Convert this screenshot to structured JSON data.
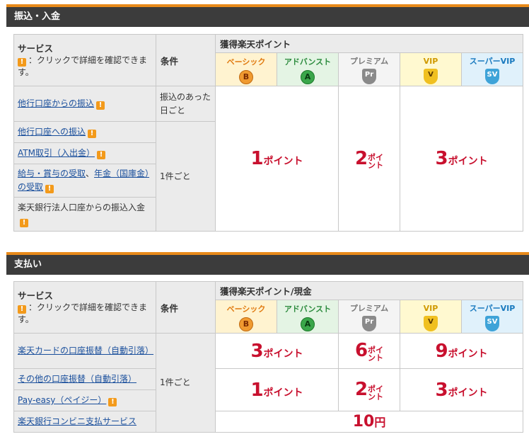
{
  "deposit": {
    "title": "振込・入金",
    "header": {
      "service_title": "サービス",
      "service_note": "：クリックで詳細を確認できます。",
      "condition": "条件",
      "points": "獲得楽天ポイント"
    },
    "ranks": [
      {
        "label": "ベーシック",
        "badge": "B",
        "label_color": "#e07a10",
        "bg": "#fff3d0",
        "badge_bg": "#f09a30"
      },
      {
        "label": "アドバンスト",
        "badge": "A",
        "label_color": "#2a8a3c",
        "bg": "#e4f4e4",
        "badge_bg": "#3aa64a"
      },
      {
        "label": "プレミアム",
        "badge": "Pr",
        "label_color": "#777777",
        "bg": "#f4f4f4",
        "badge_bg": "#8a8a8a"
      },
      {
        "label": "VIP",
        "badge": "V",
        "label_color": "#d09a00",
        "bg": "#fff9d0",
        "badge_bg": "#f0c020"
      },
      {
        "label": "スーパーVIP",
        "badge": "SV",
        "label_color": "#1a7abf",
        "bg": "#e0f1fb",
        "badge_bg": "#3ea3d8"
      }
    ],
    "rows": [
      {
        "service": "他行口座からの振込"
      },
      {
        "service": "他行口座への振込"
      },
      {
        "service": "ATM取引（入出金）"
      },
      {
        "service": "給与・賞与の受取、年金（国庫金）の受取",
        "part1": "給与・賞与の受取",
        "sep": "、",
        "part2": "年金（国庫金）の受取"
      },
      {
        "service": "楽天銀行法人口座からの振込入金"
      }
    ],
    "cond1": "振込のあった日ごと",
    "cond2": "1件ごと",
    "values": {
      "basic_adv_num": "1",
      "basic_adv_unit": "ポイント",
      "prem_num": "2",
      "prem_unit_a": "ポイ",
      "prem_unit_b": "ント",
      "vip_num": "3",
      "vip_unit": "ポイント"
    }
  },
  "payment": {
    "title": "支払い",
    "header": {
      "service_title": "サービス",
      "service_note": "：クリックで詳細を確認できます。",
      "condition": "条件",
      "points": "獲得楽天ポイント/現金"
    },
    "rows": [
      {
        "service": "楽天カードの口座振替（自動引落）",
        "v1_num": "3",
        "v2_num": "6",
        "v3_num": "9"
      },
      {
        "service": "その他の口座振替（自動引落）",
        "v1_num": "1",
        "v2_num": "2",
        "v3_num": "3"
      },
      {
        "service": "Pay-easy（ペイジー）"
      },
      {
        "service": "楽天銀行コンビニ支払サービス"
      }
    ],
    "cond": "1件ごと",
    "unit": "ポイント",
    "unit_a": "ポイ",
    "unit_b": "ント",
    "cash_num": "10",
    "cash_unit": "円"
  },
  "warn_symbol": "!"
}
